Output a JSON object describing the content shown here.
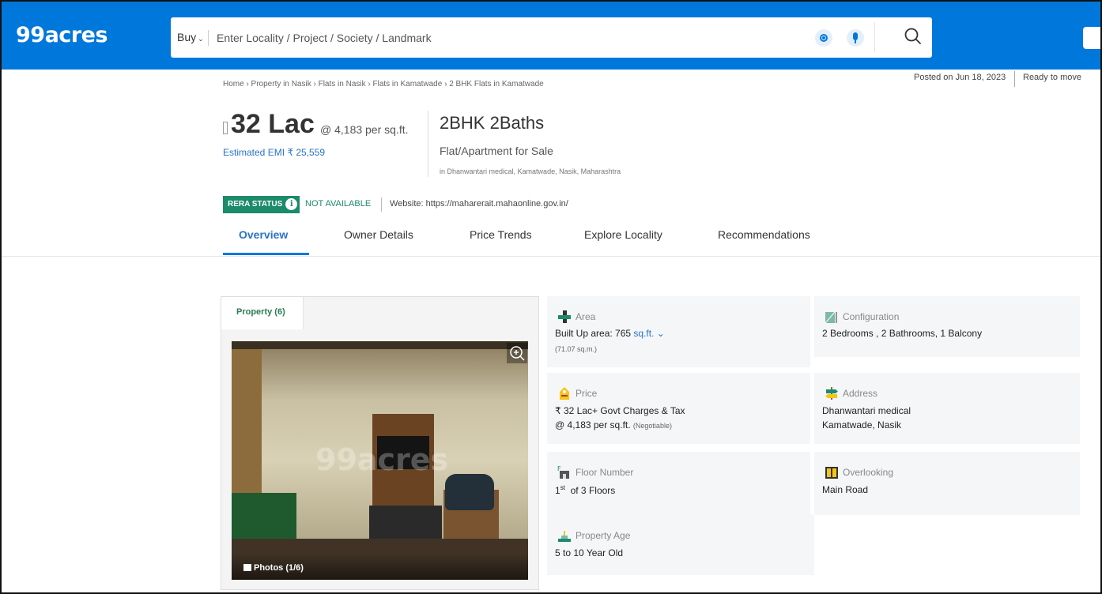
{
  "header": {
    "logo": "99acres",
    "buy_label": "Buy",
    "search_placeholder": "Enter Locality / Project / Society / Landmark"
  },
  "breadcrumb": "Home › Property in Nasik › Flats in Nasik › Flats in Kamatwade › 2 BHK Flats in Kamatwade",
  "meta": {
    "posted": "Posted on Jun 18, 2023",
    "status": "Ready to move"
  },
  "price": {
    "amount": "32 Lac",
    "per_sqft": "@ 4,183 per sq.ft.",
    "emi": "Estimated EMI ₹ 25,559"
  },
  "title": {
    "config": "2BHK 2Baths",
    "type": "Flat/Apartment for Sale",
    "location": "in Dhanwantari medical, Kamatwade, Nasik, Maharashtra"
  },
  "rera": {
    "badge": "RERA STATUS",
    "status": "NOT AVAILABLE",
    "website": "Website: https://maharerait.mahaonline.gov.in/"
  },
  "tabs": [
    "Overview",
    "Owner Details",
    "Price Trends",
    "Explore Locality",
    "Recommendations"
  ],
  "gallery": {
    "tab_label": "Property (6)",
    "watermark": "99acres",
    "photo_count": "Photos (1/6)"
  },
  "details": {
    "area": {
      "label": "Area",
      "value": "Built Up area: 765",
      "unit": "sq.ft.",
      "sub": "(71.07 sq.m.)"
    },
    "configuration": {
      "label": "Configuration",
      "value": "2 Bedrooms , 2 Bathrooms, 1 Balcony"
    },
    "price": {
      "label": "Price",
      "line1": "₹ 32 Lac+ Govt Charges & Tax",
      "line2": "@ 4,183 per sq.ft.",
      "negotiable": "(Negotiable)"
    },
    "address": {
      "label": "Address",
      "line1": "Dhanwantari medical",
      "line2": "Kamatwade, Nasik"
    },
    "floor": {
      "label": "Floor Number",
      "floor_num": "1",
      "floor_suffix": "st",
      "value": "of 3 Floors"
    },
    "overlooking": {
      "label": "Overlooking",
      "value": "Main Road"
    },
    "age": {
      "label": "Property Age",
      "value": "5 to 10 Year Old"
    }
  },
  "colors": {
    "header_bg": "#0078db",
    "link": "#2a73c8",
    "rera_green": "#1b8b6a",
    "icon_green": "#1b8b6a",
    "icon_yellow": "#f5c518"
  }
}
